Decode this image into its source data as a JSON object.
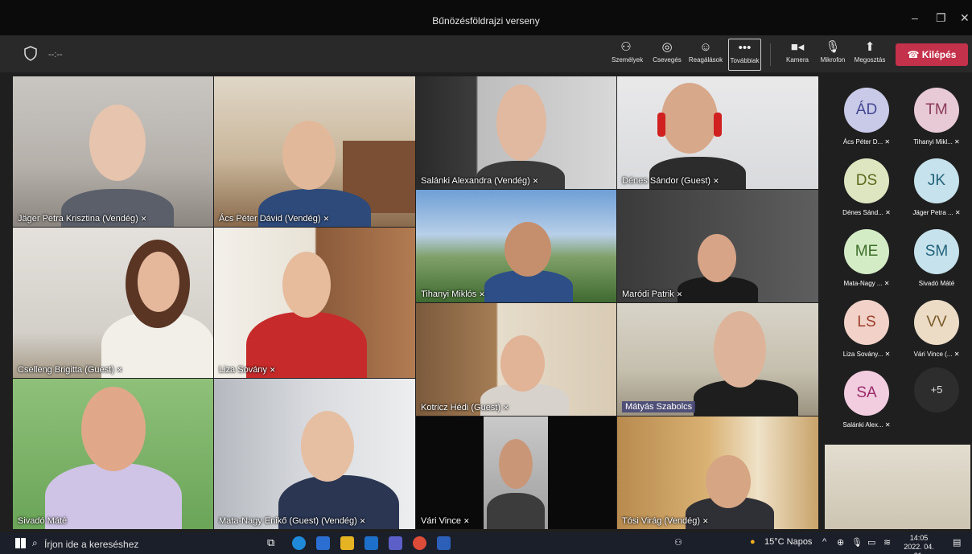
{
  "window": {
    "title": "Bűnözésföldrajzi verseny",
    "minimize": "–",
    "maximize": "❐",
    "close": "✕"
  },
  "toolbar": {
    "timer": "--:--",
    "people": "Személyek",
    "chat": "Csevegés",
    "reactions": "Reagálások",
    "more": "Továbbiak",
    "camera": "Kamera",
    "mic": "Mikrofon",
    "share": "Megosztás",
    "leave": "Kilépés"
  },
  "tiles": [
    "Jäger Petra Krisztina (Vendég)",
    "Ács Péter Dávid (Vendég)",
    "Salánki Alexandra (Vendég)",
    "Dénes Sándor (Guest)",
    "Tihanyi Miklós",
    "Maródi Patrik",
    "Cselleng Brigitta (Guest)",
    "Liza Sovány",
    "Kotricz Hédi (Guest)",
    "Mátyás Szabolcs",
    "Sivadó Máté",
    "Mata-Nagy Enikő (Guest) (Vendég)",
    "Vári Vince",
    "Tósi Virág (Vendég)"
  ],
  "roster": [
    {
      "initials": "ÁD",
      "label": "Ács Péter D..."
    },
    {
      "initials": "TM",
      "label": "Tihanyi Mikl..."
    },
    {
      "initials": "DS",
      "label": "Dénes Sánd..."
    },
    {
      "initials": "JK",
      "label": "Jäger Petra ..."
    },
    {
      "initials": "ME",
      "label": "Mata-Nagy ..."
    },
    {
      "initials": "SM",
      "label": "Sivadó Máté"
    },
    {
      "initials": "LS",
      "label": "Liza Sovány..."
    },
    {
      "initials": "VV",
      "label": "Vári Vince (..."
    },
    {
      "initials": "SA",
      "label": "Salánki Alex..."
    }
  ],
  "roster_more": "+5",
  "taskbar": {
    "search_placeholder": "Írjon ide a kereséshez",
    "weather": "15°C Napos",
    "time": "14:05",
    "date": "2022. 04. 21."
  },
  "colors": {
    "leave": "#c4314b",
    "avatar_bg": "#c8cae8",
    "name_highlight": "#464775"
  }
}
